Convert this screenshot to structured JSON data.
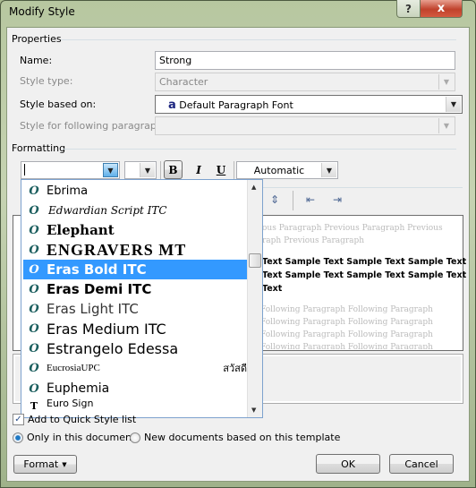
{
  "window": {
    "title": "Modify Style",
    "help_icon": "?",
    "close_icon": "x"
  },
  "properties": {
    "legend": "Properties",
    "name_label": "Name:",
    "name_value": "Strong",
    "style_type_label": "Style type:",
    "style_type_value": "Character",
    "based_on_label": "Style based on:",
    "based_on_icon": "a",
    "based_on_value": "Default Paragraph Font",
    "following_label": "Style for following paragraph:",
    "following_value": ""
  },
  "formatting": {
    "legend": "Formatting",
    "font_value": "",
    "size_value": "",
    "bold": "B",
    "italic": "I",
    "underline": "U",
    "color_value": "Automatic",
    "bold_active": true
  },
  "font_list": {
    "items": [
      {
        "name": "Ebrima",
        "type": "opentype"
      },
      {
        "name": "Edwardian Script ITC",
        "type": "opentype"
      },
      {
        "name": "Elephant",
        "type": "opentype"
      },
      {
        "name": "ENGRAVERS MT",
        "type": "opentype"
      },
      {
        "name": "Eras Bold ITC",
        "type": "opentype",
        "selected": true
      },
      {
        "name": "Eras Demi ITC",
        "type": "opentype"
      },
      {
        "name": "Eras Light ITC",
        "type": "opentype"
      },
      {
        "name": "Eras Medium ITC",
        "type": "opentype"
      },
      {
        "name": "Estrangelo Edessa",
        "type": "opentype"
      },
      {
        "name": "EucrosiaUPC",
        "type": "opentype",
        "sample": "สวัสดี"
      },
      {
        "name": "Euphemia",
        "type": "opentype"
      },
      {
        "name": "Euro Sign",
        "type": "truetype"
      }
    ],
    "opentype_glyph": "O",
    "truetype_glyph": "T"
  },
  "preview": {
    "previous": [
      "ous Paragraph Previous Paragraph Previous",
      "raph Previous Paragraph"
    ],
    "sample": [
      "Text Sample Text Sample Text Sample Text",
      "Text Sample Text Sample Text Sample Text",
      "Text"
    ],
    "following": [
      "Following Paragraph Following Paragraph",
      "Following Paragraph Following Paragraph",
      "Following Paragraph Following Paragraph",
      "Following Paragraph Following Paragraph"
    ]
  },
  "options": {
    "quick_style_label": "Add to Quick Style list",
    "quick_style_checked": true,
    "only_doc_label": "Only in this document",
    "new_docs_label": "New documents based on this template",
    "selected": "only_doc"
  },
  "buttons": {
    "format": "Format",
    "ok": "OK",
    "cancel": "Cancel"
  }
}
